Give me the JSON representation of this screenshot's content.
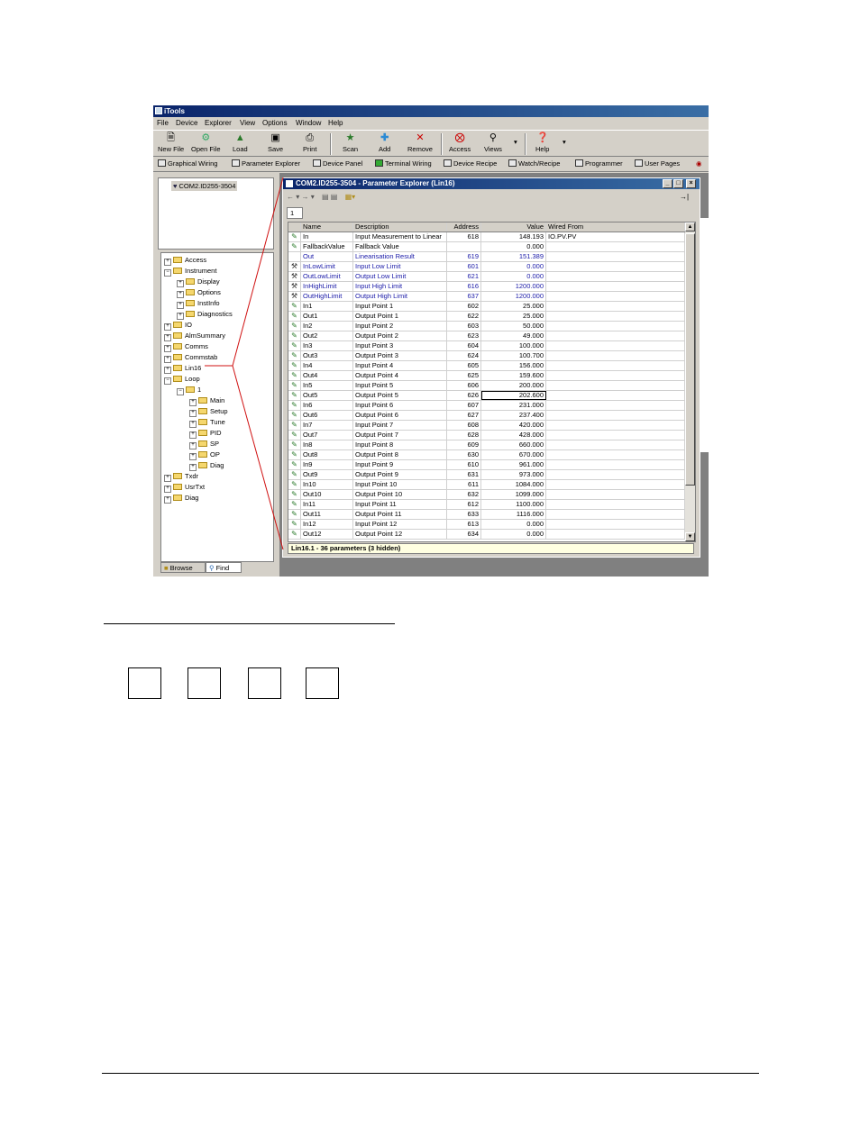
{
  "window": {
    "title": "iTools"
  },
  "menu": [
    "File",
    "Device",
    "Explorer",
    "View",
    "Options",
    "Window",
    "Help"
  ],
  "toolbar": [
    {
      "label": "New File",
      "icon": "new-file-icon"
    },
    {
      "label": "Open File",
      "icon": "open-file-icon"
    },
    {
      "label": "Load",
      "icon": "load-icon"
    },
    {
      "label": "Save",
      "icon": "save-icon"
    },
    {
      "label": "Print",
      "icon": "print-icon"
    },
    {
      "label": "Scan",
      "icon": "scan-icon"
    },
    {
      "label": "Add",
      "icon": "add-icon"
    },
    {
      "label": "Remove",
      "icon": "remove-icon"
    },
    {
      "label": "Access",
      "icon": "access-icon"
    },
    {
      "label": "Views",
      "icon": "views-icon"
    },
    {
      "label": "Help",
      "icon": "help-icon"
    }
  ],
  "toolbar2": [
    "Graphical Wiring",
    "Parameter Explorer",
    "Device Panel",
    "Terminal Wiring",
    "Device Recipe",
    "Watch/Recipe",
    "Programmer",
    "User Pages"
  ],
  "device": {
    "name": "COM2.ID255-3504"
  },
  "tree": [
    {
      "label": "Access"
    },
    {
      "label": "Instrument"
    },
    {
      "label": "Display"
    },
    {
      "label": "Options"
    },
    {
      "label": "InstInfo"
    },
    {
      "label": "Diagnostics"
    },
    {
      "label": "IO"
    },
    {
      "label": "AlmSummary"
    },
    {
      "label": "Comms"
    },
    {
      "label": "Commstab"
    },
    {
      "label": "Lin16"
    },
    {
      "label": "Loop"
    },
    {
      "label": "1"
    },
    {
      "label": "Main"
    },
    {
      "label": "Setup"
    },
    {
      "label": "Tune"
    },
    {
      "label": "PID"
    },
    {
      "label": "SP"
    },
    {
      "label": "OP"
    },
    {
      "label": "Diag"
    },
    {
      "label": "Txdr"
    },
    {
      "label": "UsrTxt"
    },
    {
      "label": "Diag"
    }
  ],
  "panel_tabs": {
    "browse": "Browse",
    "find": "Find"
  },
  "explorer": {
    "title": "COM2.ID255-3504 - Parameter Explorer (Lin16)",
    "tab": "1",
    "columns": [
      "Name",
      "Description",
      "Address",
      "Value",
      "Wired From"
    ],
    "rows": [
      {
        "name": "In",
        "desc": "Input Measurement to Linear",
        "addr": "618",
        "value": "148.193",
        "wired": "IO.PV.PV"
      },
      {
        "name": "FallbackValue",
        "desc": "Fallback Value",
        "addr": "",
        "value": "0.000",
        "wired": ""
      },
      {
        "name": "Out",
        "desc": "Linearisation Result",
        "addr": "619",
        "value": "151.389",
        "wired": ""
      },
      {
        "name": "InLowLimit",
        "desc": "Input Low Limit",
        "addr": "601",
        "value": "0.000",
        "wired": ""
      },
      {
        "name": "OutLowLimit",
        "desc": "Output Low Limit",
        "addr": "621",
        "value": "0.000",
        "wired": ""
      },
      {
        "name": "InHighLimit",
        "desc": "Input High Limit",
        "addr": "616",
        "value": "1200.000",
        "wired": ""
      },
      {
        "name": "OutHighLimit",
        "desc": "Output High Limit",
        "addr": "637",
        "value": "1200.000",
        "wired": ""
      },
      {
        "name": "In1",
        "desc": "Input Point 1",
        "addr": "602",
        "value": "25.000",
        "wired": ""
      },
      {
        "name": "Out1",
        "desc": "Output Point 1",
        "addr": "622",
        "value": "25.000",
        "wired": ""
      },
      {
        "name": "In2",
        "desc": "Input Point 2",
        "addr": "603",
        "value": "50.000",
        "wired": ""
      },
      {
        "name": "Out2",
        "desc": "Output Point 2",
        "addr": "623",
        "value": "49.000",
        "wired": ""
      },
      {
        "name": "In3",
        "desc": "Input Point 3",
        "addr": "604",
        "value": "100.000",
        "wired": ""
      },
      {
        "name": "Out3",
        "desc": "Output Point 3",
        "addr": "624",
        "value": "100.700",
        "wired": ""
      },
      {
        "name": "In4",
        "desc": "Input Point 4",
        "addr": "605",
        "value": "156.000",
        "wired": ""
      },
      {
        "name": "Out4",
        "desc": "Output Point 4",
        "addr": "625",
        "value": "159.600",
        "wired": ""
      },
      {
        "name": "In5",
        "desc": "Input Point 5",
        "addr": "606",
        "value": "200.000",
        "wired": ""
      },
      {
        "name": "Out5",
        "desc": "Output Point 5",
        "addr": "626",
        "value": "202.600",
        "wired": ""
      },
      {
        "name": "In6",
        "desc": "Input Point 6",
        "addr": "607",
        "value": "231.000",
        "wired": ""
      },
      {
        "name": "Out6",
        "desc": "Output Point 6",
        "addr": "627",
        "value": "237.400",
        "wired": ""
      },
      {
        "name": "In7",
        "desc": "Input Point 7",
        "addr": "608",
        "value": "420.000",
        "wired": ""
      },
      {
        "name": "Out7",
        "desc": "Output Point 7",
        "addr": "628",
        "value": "428.000",
        "wired": ""
      },
      {
        "name": "In8",
        "desc": "Input Point 8",
        "addr": "609",
        "value": "660.000",
        "wired": ""
      },
      {
        "name": "Out8",
        "desc": "Output Point 8",
        "addr": "630",
        "value": "670.000",
        "wired": ""
      },
      {
        "name": "In9",
        "desc": "Input Point 9",
        "addr": "610",
        "value": "961.000",
        "wired": ""
      },
      {
        "name": "Out9",
        "desc": "Output Point 9",
        "addr": "631",
        "value": "973.000",
        "wired": ""
      },
      {
        "name": "In10",
        "desc": "Input Point 10",
        "addr": "611",
        "value": "1084.000",
        "wired": ""
      },
      {
        "name": "Out10",
        "desc": "Output Point 10",
        "addr": "632",
        "value": "1099.000",
        "wired": ""
      },
      {
        "name": "In11",
        "desc": "Input Point 11",
        "addr": "612",
        "value": "1100.000",
        "wired": ""
      },
      {
        "name": "Out11",
        "desc": "Output Point 11",
        "addr": "633",
        "value": "1116.000",
        "wired": ""
      },
      {
        "name": "In12",
        "desc": "Input Point 12",
        "addr": "613",
        "value": "0.000",
        "wired": ""
      },
      {
        "name": "Out12",
        "desc": "Output Point 12",
        "addr": "634",
        "value": "0.000",
        "wired": ""
      }
    ],
    "status": "Lin16.1  -  36 parameters (3 hidden)"
  }
}
